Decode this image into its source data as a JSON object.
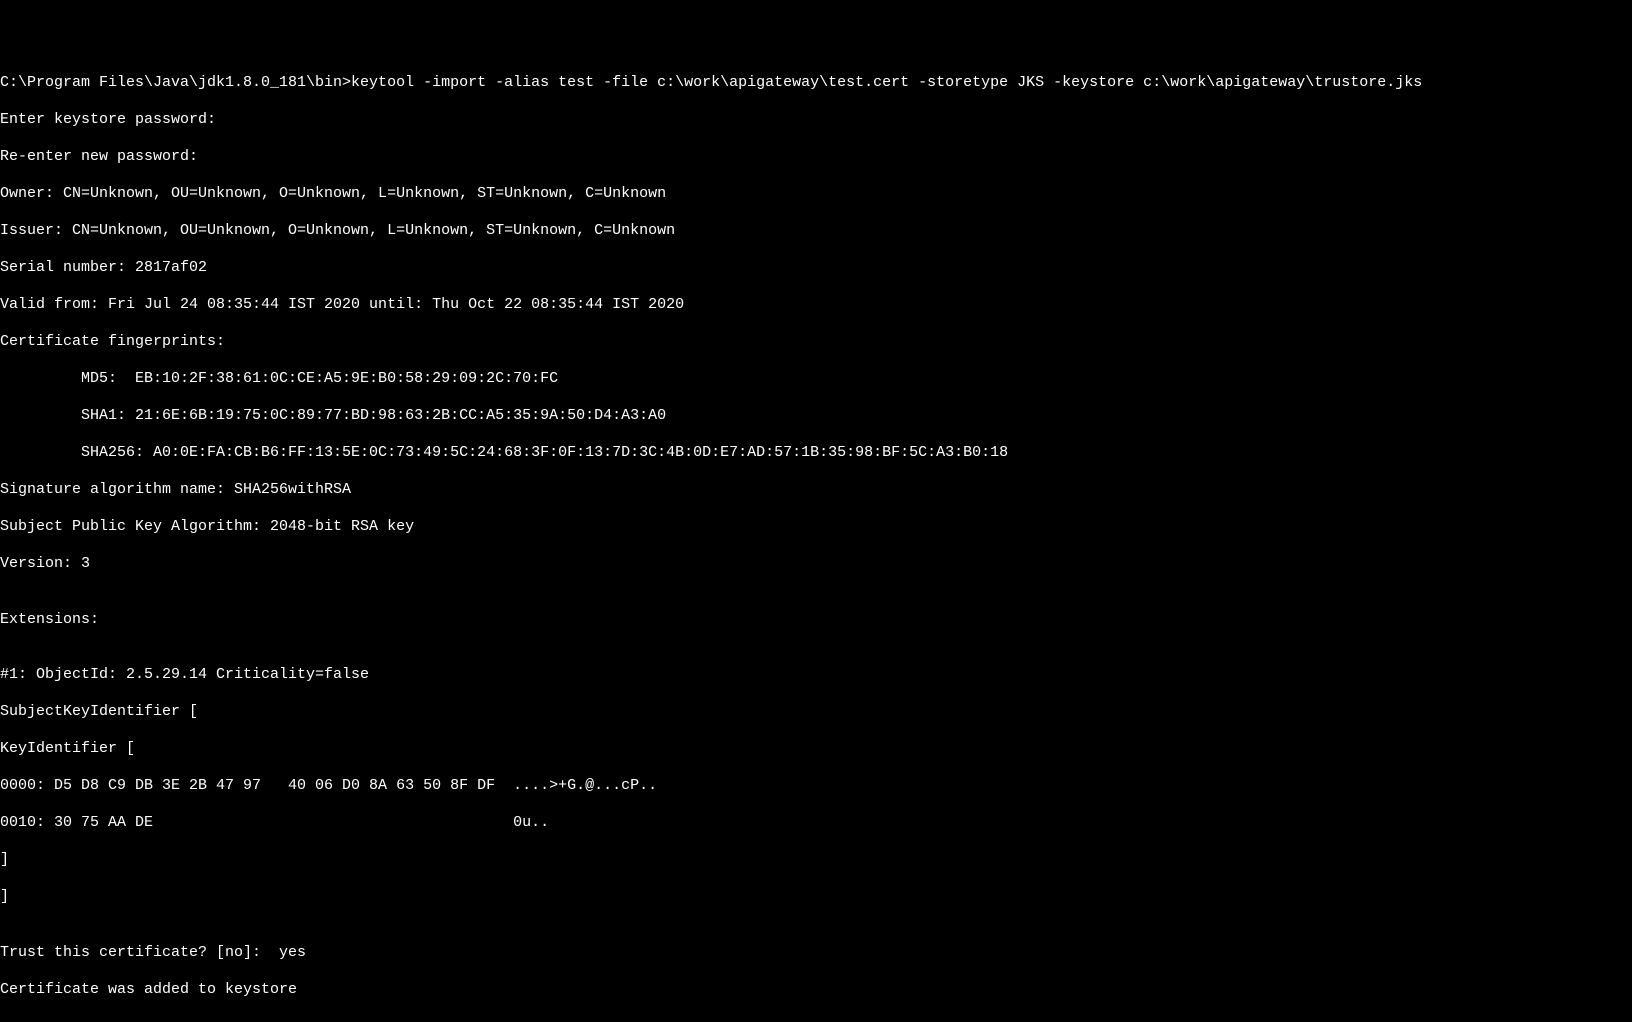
{
  "terminal": {
    "command_line": "C:\\Program Files\\Java\\jdk1.8.0_181\\bin>keytool -import -alias test -file c:\\work\\apigateway\\test.cert -storetype JKS -keystore c:\\work\\apigateway\\trustore.jks",
    "prompt_enter_password": "Enter keystore password:",
    "prompt_reenter_password": "Re-enter new password:",
    "owner": "Owner: CN=Unknown, OU=Unknown, O=Unknown, L=Unknown, ST=Unknown, C=Unknown",
    "issuer": "Issuer: CN=Unknown, OU=Unknown, O=Unknown, L=Unknown, ST=Unknown, C=Unknown",
    "serial_number": "Serial number: 2817af02",
    "valid_from": "Valid from: Fri Jul 24 08:35:44 IST 2020 until: Thu Oct 22 08:35:44 IST 2020",
    "cert_fingerprints_label": "Certificate fingerprints:",
    "md5": "         MD5:  EB:10:2F:38:61:0C:CE:A5:9E:B0:58:29:09:2C:70:FC",
    "sha1": "         SHA1: 21:6E:6B:19:75:0C:89:77:BD:98:63:2B:CC:A5:35:9A:50:D4:A3:A0",
    "sha256": "         SHA256: A0:0E:FA:CB:B6:FF:13:5E:0C:73:49:5C:24:68:3F:0F:13:7D:3C:4B:0D:E7:AD:57:1B:35:98:BF:5C:A3:B0:18",
    "sig_algorithm": "Signature algorithm name: SHA256withRSA",
    "subject_pubkey": "Subject Public Key Algorithm: 2048-bit RSA key",
    "version": "Version: 3",
    "blank1": "",
    "extensions_label": "Extensions:",
    "blank2": "",
    "ext1_header": "#1: ObjectId: 2.5.29.14 Criticality=false",
    "subject_key_id": "SubjectKeyIdentifier [",
    "key_id": "KeyIdentifier [",
    "hex_line1": "0000: D5 D8 C9 DB 3E 2B 47 97   40 06 D0 8A 63 50 8F DF  ....>+G.@...cP..",
    "hex_line2": "0010: 30 75 AA DE                                        0u..",
    "close_bracket1": "]",
    "close_bracket2": "]",
    "blank3": "",
    "trust_prompt": "Trust this certificate? [no]:  yes",
    "cert_added": "Certificate was added to keystore"
  }
}
